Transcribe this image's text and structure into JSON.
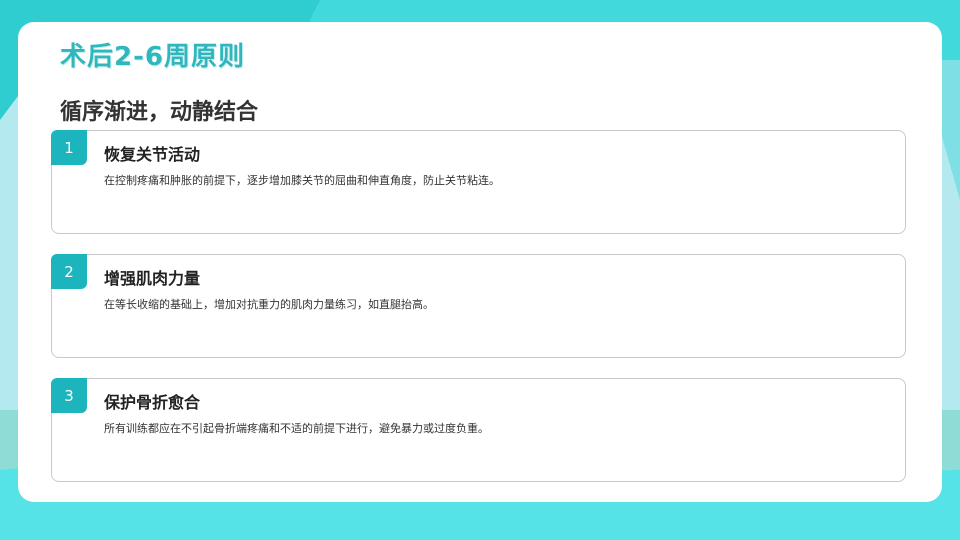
{
  "page": {
    "title": "术后2-6周原则",
    "subtitle": "循序渐进，动静结合"
  },
  "items": [
    {
      "num": "1",
      "title": "恢复关节活动",
      "desc": "在控制疼痛和肿胀的前提下，逐步增加膝关节的屈曲和伸直角度，防止关节粘连。"
    },
    {
      "num": "2",
      "title": "增强肌肉力量",
      "desc": "在等长收缩的基础上，增加对抗重力的肌肉力量练习，如直腿抬高。"
    },
    {
      "num": "3",
      "title": "保护骨折愈合",
      "desc": "所有训练都应在不引起骨折端疼痛和不适的前提下进行，避免暴力或过度负重。"
    }
  ],
  "colors": {
    "accent": "#1cb4bd",
    "title": "#2fb7bd",
    "wave_light": "#b4e9ef",
    "wave_mid": "#55e3e7",
    "band": "#8fdcd6"
  }
}
